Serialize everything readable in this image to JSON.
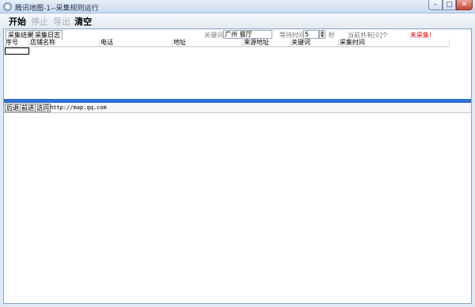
{
  "window": {
    "title": "腾讯地图-1--采集规则运行",
    "min_glyph": "–",
    "max_glyph": "□",
    "close_glyph": "✕"
  },
  "menu": {
    "start": "开始",
    "stop": "停止",
    "export": "导出",
    "clear": "清空"
  },
  "tabs": [
    "采集结果",
    "采集日志"
  ],
  "toolbar": {
    "keyword_label": "关键词",
    "keyword_value": "广州 餐厅",
    "wait_label": "等待时间",
    "wait_value": "5",
    "seconds_unit": "秒",
    "count_text": "当前共有[0]个",
    "status_text": "未采集!"
  },
  "table": {
    "columns": [
      "序号",
      "店铺名称",
      "电话",
      "地址",
      "来源地址",
      "关键词",
      "采集时间"
    ]
  },
  "browser": {
    "back": "后退",
    "forward": "前进",
    "visit": "访问",
    "url": "http://map.qq.com"
  },
  "colors": {
    "status": "#e60000",
    "splitter": "#2f6fd0"
  }
}
